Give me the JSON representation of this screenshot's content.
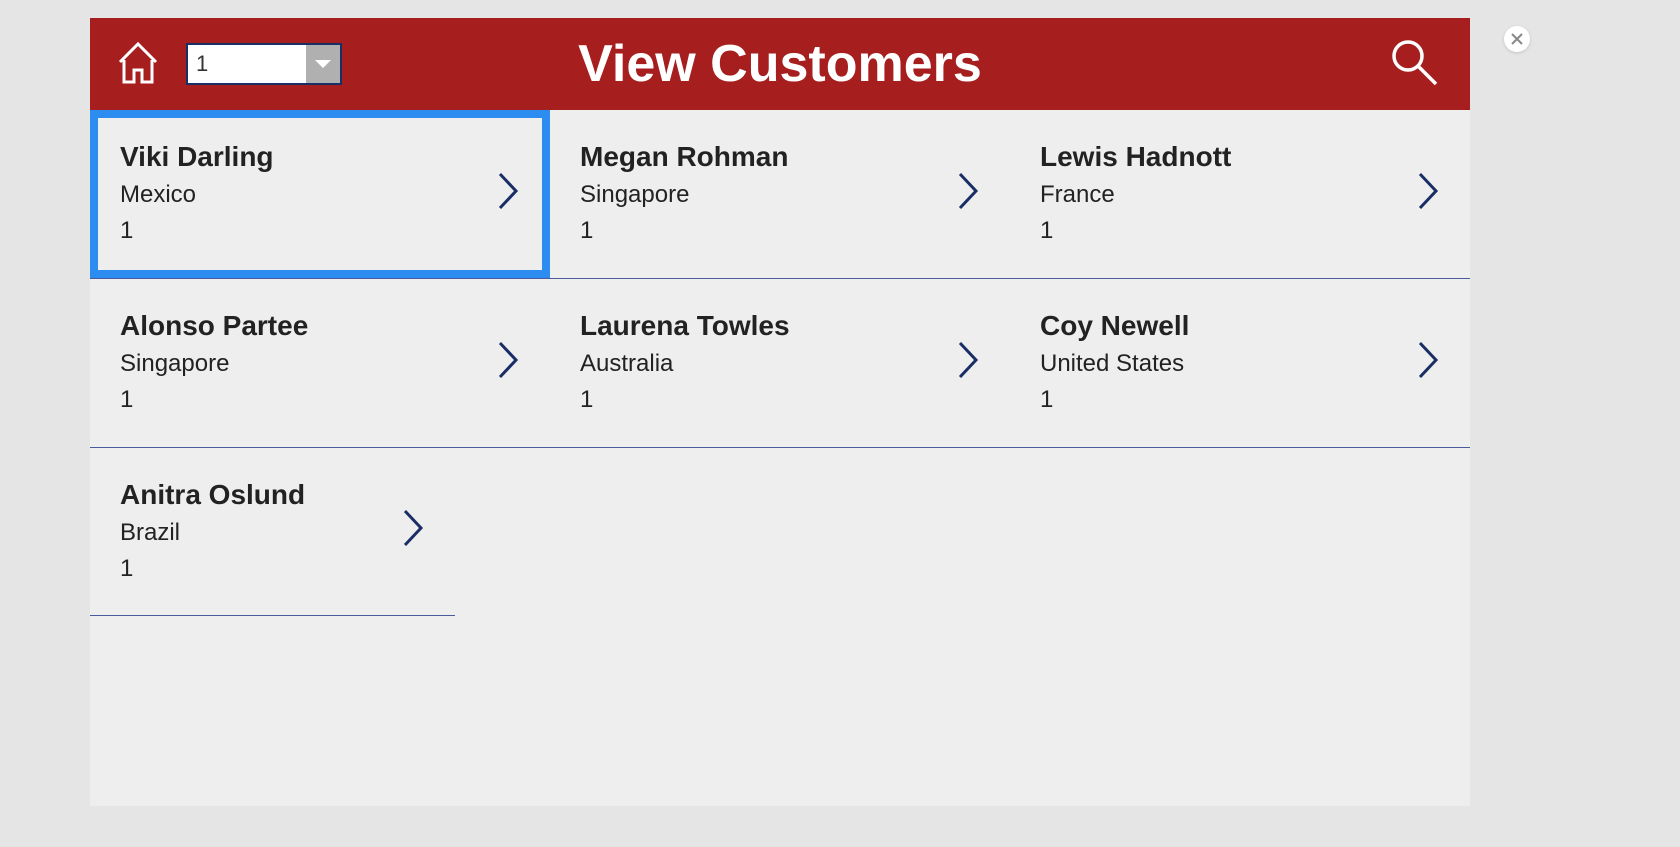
{
  "header": {
    "title": "View Customers",
    "dropdown_value": "1"
  },
  "customers": [
    {
      "name": "Viki  Darling",
      "country": "Mexico",
      "number": "1",
      "selected": true
    },
    {
      "name": "Megan  Rohman",
      "country": "Singapore",
      "number": "1",
      "selected": false
    },
    {
      "name": "Lewis  Hadnott",
      "country": "France",
      "number": "1",
      "selected": false
    },
    {
      "name": "Alonso  Partee",
      "country": "Singapore",
      "number": "1",
      "selected": false
    },
    {
      "name": "Laurena  Towles",
      "country": "Australia",
      "number": "1",
      "selected": false
    },
    {
      "name": "Coy  Newell",
      "country": "United States",
      "number": "1",
      "selected": false
    },
    {
      "name": "Anitra  Oslund",
      "country": "Brazil",
      "number": "1",
      "selected": false
    }
  ]
}
